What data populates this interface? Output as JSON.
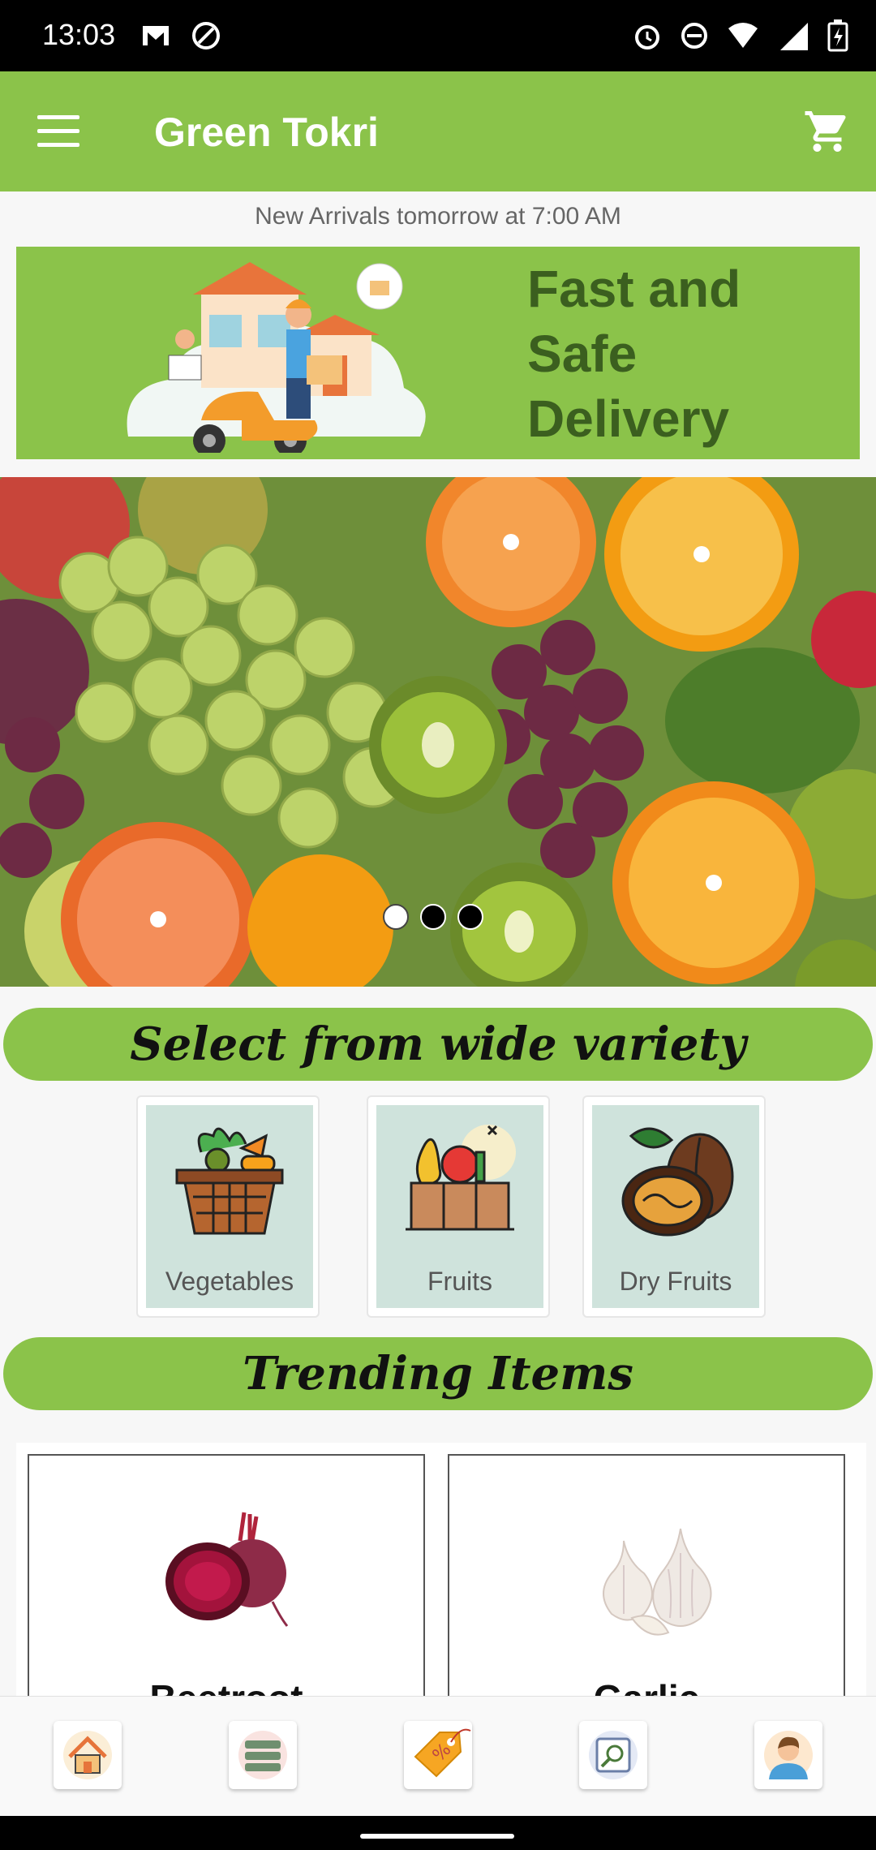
{
  "status": {
    "time": "13:03"
  },
  "appbar": {
    "title": "Green Tokri"
  },
  "notice": {
    "text": "New Arrivals tomorrow at 7:00 AM"
  },
  "banner": {
    "line1": "Fast and",
    "line2": "Safe",
    "line3": "Delivery"
  },
  "carousel": {
    "pages": 3,
    "active_page": 1
  },
  "sections": {
    "variety_title": "Select from wide variety",
    "trending_title": "Trending Items"
  },
  "categories": [
    {
      "label": "Vegetables"
    },
    {
      "label": "Fruits"
    },
    {
      "label": "Dry Fruits"
    }
  ],
  "trending": [
    {
      "name": "Beetroot"
    },
    {
      "name": "Garlic"
    }
  ],
  "bottom_nav": [
    "home-icon",
    "list-icon",
    "discount-icon",
    "search-icon",
    "profile-icon"
  ],
  "colors": {
    "accent": "#8bc34a",
    "banner_text": "#3b5f1f",
    "category_bg": "#cfe3dc"
  }
}
